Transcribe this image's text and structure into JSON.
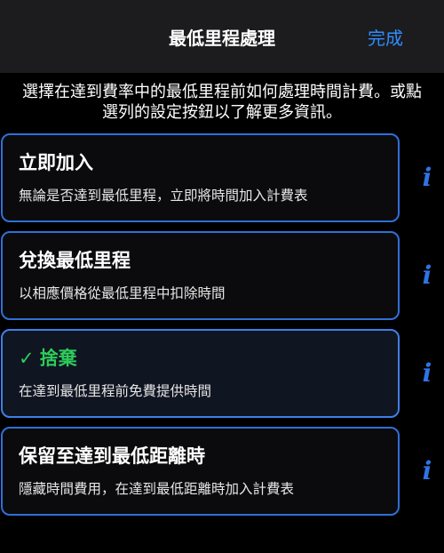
{
  "header": {
    "title": "最低里程處理",
    "done_label": "完成"
  },
  "instructions": "選擇在達到費率中的最低里程前如何處理時間計費。或點選列的設定按鈕以了解更多資訊。",
  "options": [
    {
      "title": "立即加入",
      "description": "無論是否達到最低里程，立即將時間加入計費表",
      "info_glyph": "i",
      "selected": false
    },
    {
      "title": "兌換最低里程",
      "description": "以相應價格從最低里程中扣除時間",
      "info_glyph": "i",
      "selected": false
    },
    {
      "title": "捨棄",
      "description": "在達到最低里程前免費提供時間",
      "info_glyph": "i",
      "selected": true,
      "check_glyph": "✓"
    },
    {
      "title": "保留至達到最低距離時",
      "description": "隱藏時間費用，在達到最低距離時加入計費表",
      "info_glyph": "i",
      "selected": false
    }
  ],
  "colors": {
    "accent": "#2f8cff",
    "card_border": "#2f6fd8",
    "selected_text": "#2ecc5a",
    "info_icon": "#2f74e6"
  }
}
